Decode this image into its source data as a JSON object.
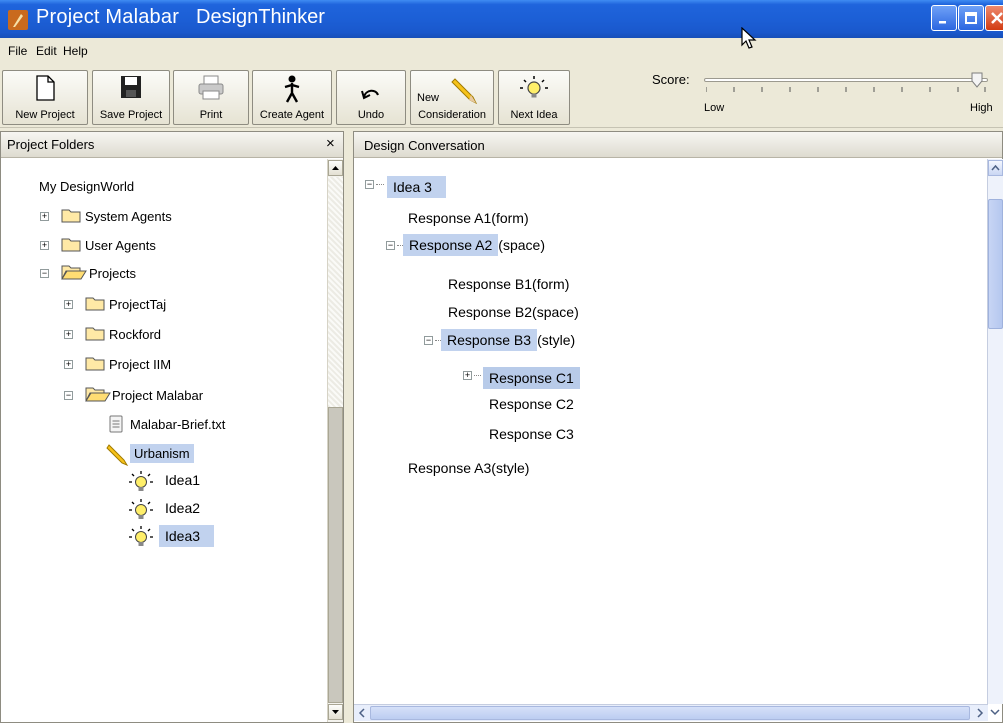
{
  "window": {
    "title": "Project Malabar",
    "app_name": "DesignThinker"
  },
  "menu": [
    "File",
    "Edit",
    "Help"
  ],
  "toolbar": {
    "new_project": "New Project",
    "save_project": "Save Project",
    "print": "Print",
    "create_agent": "Create Agent",
    "undo": "Undo",
    "new_consideration_1": "New",
    "new_consideration_2": "Consideration",
    "next_idea": "Next Idea"
  },
  "score": {
    "label": "Score:",
    "low": "Low",
    "high": "High",
    "value_fraction": 0.96
  },
  "left_panel": {
    "title": "Project Folders",
    "close": "×",
    "root": "My DesignWorld",
    "system_agents": "System Agents",
    "user_agents": "User Agents",
    "projects": "Projects",
    "project_taj": "ProjectTaj",
    "rockford": "Rockford",
    "project_iim": "Project IIM",
    "project_malabar": "Project Malabar",
    "brief_file": "Malabar-Brief.txt",
    "urbanism": "Urbanism",
    "idea1": "Idea1",
    "idea2": "Idea2",
    "idea3": "Idea3"
  },
  "right_panel": {
    "title": "Design Conversation",
    "idea": "Idea 3",
    "a1": "Response A1(form)",
    "a2_hl": "Response A2",
    "a2_rest": "(space)",
    "b1": "Response B1(form)",
    "b2": "Response B2(space)",
    "b3_hl": "Response B3",
    "b3_rest": "(style)",
    "c1": "Response C1",
    "c2": "Response C2",
    "c3": "Response C3",
    "a3": "Response A3(style)"
  }
}
